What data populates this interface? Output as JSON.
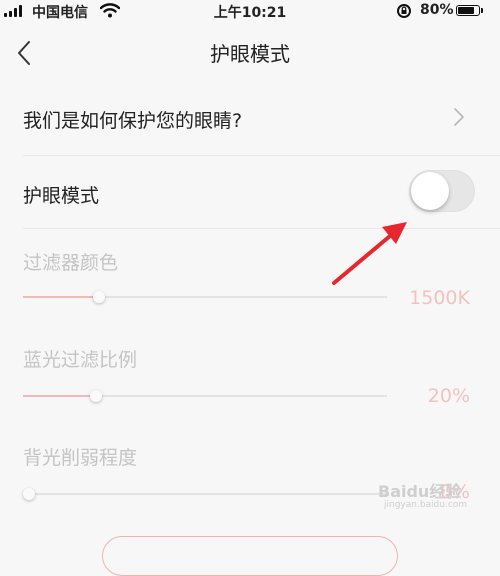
{
  "status_bar": {
    "carrier": "中国电信",
    "time": "上午10:21",
    "battery": "80%"
  },
  "nav": {
    "title": "护眼模式",
    "back_icon": "chevron-left-icon"
  },
  "rows": {
    "how_protect": {
      "label": "我们是如何保护您的眼睛?",
      "icon": "chevron-right-icon"
    },
    "eye_mode": {
      "label": "护眼模式",
      "toggle_on": false
    }
  },
  "sliders": [
    {
      "label": "过滤器颜色",
      "value": "1500K",
      "level": 0.21
    },
    {
      "label": "蓝光过滤比例",
      "value": "20%",
      "level": 0.2
    },
    {
      "label": "背光削弱程度",
      "value": "0%",
      "level": 0.0
    }
  ],
  "colors": {
    "accent": "#f2b9b5",
    "annotation_arrow": "#e8262d"
  },
  "watermark": {
    "main": "Baidu经验",
    "sub": "jingyan.baidu.com"
  }
}
